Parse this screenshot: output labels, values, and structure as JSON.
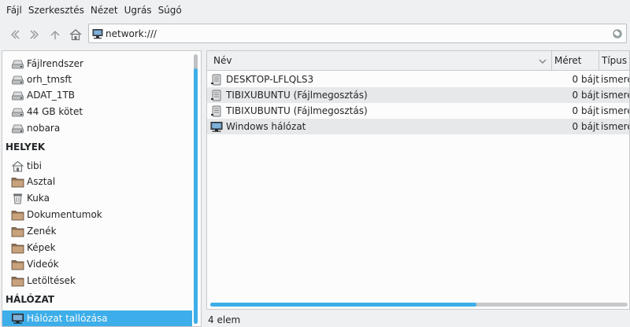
{
  "menubar": {
    "items": [
      "Fájl",
      "Szerkesztés",
      "Nézet",
      "Ugrás",
      "Súgó"
    ]
  },
  "toolbar": {
    "back_icon": "back-arrow-icon",
    "forward_icon": "forward-arrow-icon",
    "up_icon": "up-arrow-icon",
    "home_icon": "home-icon"
  },
  "address": {
    "value": "network:///"
  },
  "sidebar": {
    "devices": [
      {
        "label": "Fájlrendszer",
        "icon": "drive-icon"
      },
      {
        "label": "orh_tmsft",
        "icon": "drive-icon"
      },
      {
        "label": "ADAT_1TB",
        "icon": "drive-icon"
      },
      {
        "label": "44 GB kötet",
        "icon": "drive-icon"
      },
      {
        "label": "nobara",
        "icon": "drive-icon"
      }
    ],
    "places_heading": "HELYEK",
    "places": [
      {
        "label": "tibi",
        "icon": "home-icon"
      },
      {
        "label": "Asztal",
        "icon": "folder-icon"
      },
      {
        "label": "Kuka",
        "icon": "trash-icon"
      },
      {
        "label": "Dokumentumok",
        "icon": "folder-icon"
      },
      {
        "label": "Zenék",
        "icon": "folder-icon"
      },
      {
        "label": "Képek",
        "icon": "folder-icon"
      },
      {
        "label": "Videók",
        "icon": "folder-icon"
      },
      {
        "label": "Letöltések",
        "icon": "folder-icon"
      }
    ],
    "network_heading": "HÁLÓZAT",
    "network": [
      {
        "label": "Hálózat tallózása",
        "icon": "network-icon",
        "selected": true
      }
    ]
  },
  "main": {
    "columns": {
      "name": "Név",
      "size": "Méret",
      "type": "Típus"
    },
    "rows": [
      {
        "name": "DESKTOP-LFLQLS3",
        "size": "0 bájt",
        "type": "ismere",
        "icon": "server-icon"
      },
      {
        "name": "TIBIXUBUNTU (Fájlmegosztás)",
        "size": "0 bájt",
        "type": "ismere",
        "icon": "server-icon"
      },
      {
        "name": "TIBIXUBUNTU (Fájlmegosztás)",
        "size": "0 bájt",
        "type": "ismere",
        "icon": "server-icon"
      },
      {
        "name": "Windows hálózat",
        "size": "0 bájt",
        "type": "ismere",
        "icon": "network-icon"
      }
    ]
  },
  "status": {
    "text": "4 elem"
  },
  "colors": {
    "accent": "#3daee9",
    "window_bg": "#eff0f1",
    "view_bg": "#fcfcfc",
    "alt_row": "#e7e8e9"
  }
}
